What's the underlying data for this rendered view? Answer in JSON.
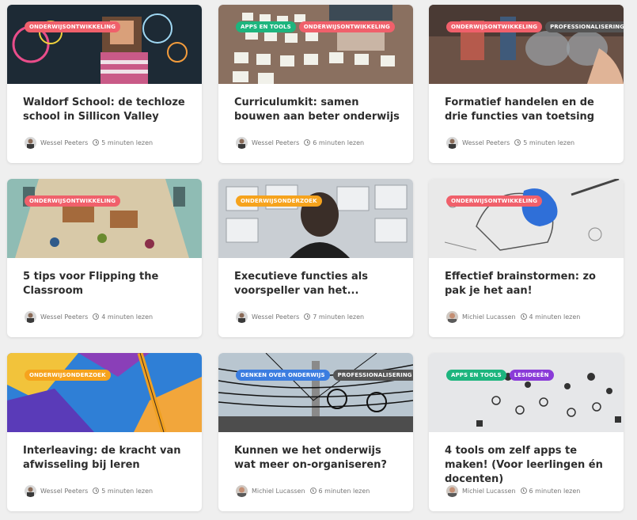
{
  "colors": {
    "onderwijsontwikkeling": "#f0606b",
    "apps_en_tools": "#1db57e",
    "professionalisering": "#555555",
    "onderwijsonderzoek": "#f6a31d",
    "denken_over_onderwijs": "#3b7de0",
    "lesideeen": "#8a3bd8"
  },
  "cards": [
    {
      "tags": [
        {
          "label": "ONDERWIJSONTWIKKELING",
          "key": "onderwijsontwikkeling"
        }
      ],
      "title": "Waldorf School: de techloze school in Sillicon Valley",
      "author": "Wessel Peeters",
      "read_time": "5 minuten lezen"
    },
    {
      "tags": [
        {
          "label": "APPS EN TOOLS",
          "key": "apps_en_tools"
        },
        {
          "label": "ONDERWIJSONTWIKKELING",
          "key": "onderwijsontwikkeling"
        }
      ],
      "title": "Curriculumkit: samen bouwen aan beter onderwijs",
      "author": "Wessel Peeters",
      "read_time": "6 minuten lezen"
    },
    {
      "tags": [
        {
          "label": "ONDERWIJSONTWIKKELING",
          "key": "onderwijsontwikkeling"
        },
        {
          "label": "PROFESSIONALISERING",
          "key": "professionalisering"
        }
      ],
      "title": "Formatief handelen en de drie functies van toetsing",
      "author": "Wessel Peeters",
      "read_time": "5 minuten lezen"
    },
    {
      "tags": [
        {
          "label": "ONDERWIJSONTWIKKELING",
          "key": "onderwijsontwikkeling"
        }
      ],
      "title": "5 tips voor Flipping the Classroom",
      "author": "Wessel Peeters",
      "read_time": "4 minuten lezen"
    },
    {
      "tags": [
        {
          "label": "ONDERWIJSONDERZOEK",
          "key": "onderwijsonderzoek"
        }
      ],
      "title": "Executieve functies als voorspeller van het...",
      "author": "Wessel Peeters",
      "read_time": "7 minuten lezen"
    },
    {
      "tags": [
        {
          "label": "ONDERWIJSONTWIKKELING",
          "key": "onderwijsontwikkeling"
        }
      ],
      "title": "Effectief brainstormen: zo pak je het aan!",
      "author": "Michiel Lucassen",
      "read_time": "4 minuten lezen"
    },
    {
      "tags": [
        {
          "label": "ONDERWIJSONDERZOEK",
          "key": "onderwijsonderzoek"
        }
      ],
      "title": "Interleaving: de kracht van afwisseling bij leren",
      "author": "Wessel Peeters",
      "read_time": "5 minuten lezen"
    },
    {
      "tags": [
        {
          "label": "DENKEN OVER ONDERWIJS",
          "key": "denken_over_onderwijs"
        },
        {
          "label": "PROFESSIONALISERING",
          "key": "professionalisering"
        }
      ],
      "title": "Kunnen we het onderwijs wat meer on-organiseren?",
      "author": "Michiel Lucassen",
      "read_time": "6 minuten lezen"
    },
    {
      "tags": [
        {
          "label": "APPS EN TOOLS",
          "key": "apps_en_tools"
        },
        {
          "label": "LESIDEEËN",
          "key": "lesideeen"
        }
      ],
      "title": "4 tools om zelf apps te maken! (Voor leerlingen én docenten)",
      "author": "Michiel Lucassen",
      "read_time": "6 minuten lezen"
    }
  ]
}
